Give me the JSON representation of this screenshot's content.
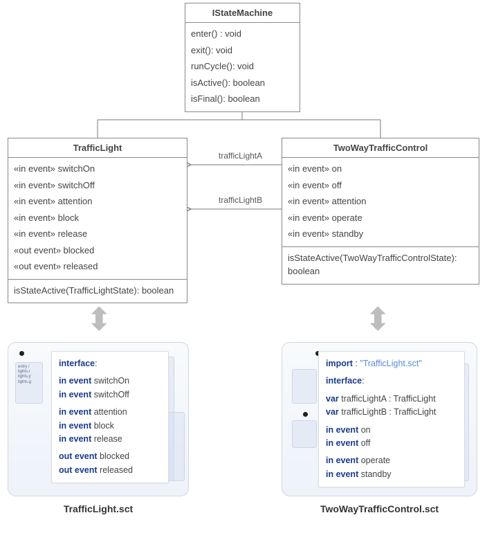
{
  "interface": {
    "name": "IStateMachine",
    "methods": [
      "enter() : void",
      "exit(): void",
      "runCycle(): void",
      "isActive(): boolean",
      "isFinal(): boolean"
    ]
  },
  "trafficLight": {
    "name": "TrafficLight",
    "events": [
      "«in event» switchOn",
      "«in event» switchOff",
      "«in event» attention",
      "«in event» block",
      "«in event» release",
      "«out event» blocked",
      "«out event» released"
    ],
    "methods": [
      "isStateActive(TrafficLightState): boolean"
    ]
  },
  "twoWay": {
    "name": "TwoWayTrafficControl",
    "events": [
      "«in event» on",
      "«in event» off",
      "«in event» attention",
      "«in event» operate",
      "«in event» standby"
    ],
    "methods": [
      "isStateActive(TwoWayTrafficControlState): boolean"
    ]
  },
  "assoc": {
    "a": "trafficLightA",
    "b": "trafficLightB"
  },
  "panels": {
    "left": {
      "caption": "TrafficLight.sct",
      "code": {
        "interface_kw": "interface",
        "in_event_kw": "in event",
        "out_event_kw": "out event",
        "events_in_1": [
          "switchOn",
          "switchOff"
        ],
        "events_in_2": [
          "attention",
          "block",
          "release"
        ],
        "events_out": [
          "blocked",
          "released"
        ]
      }
    },
    "right": {
      "caption": "TwoWayTrafficControl.sct",
      "code": {
        "import_kw": "import",
        "import_str": "\"TrafficLight.sct\"",
        "interface_kw": "interface",
        "var_kw": "var",
        "vars": [
          "trafficLightA : TrafficLight",
          "trafficLightB : TrafficLight"
        ],
        "in_event_kw": "in event",
        "events_in_1": [
          "on",
          "off"
        ],
        "events_in_2": [
          "operate",
          "standby"
        ]
      }
    }
  },
  "colors": {
    "keyword": "#1a3b8b",
    "string": "#5a8cd8",
    "border": "#888"
  }
}
